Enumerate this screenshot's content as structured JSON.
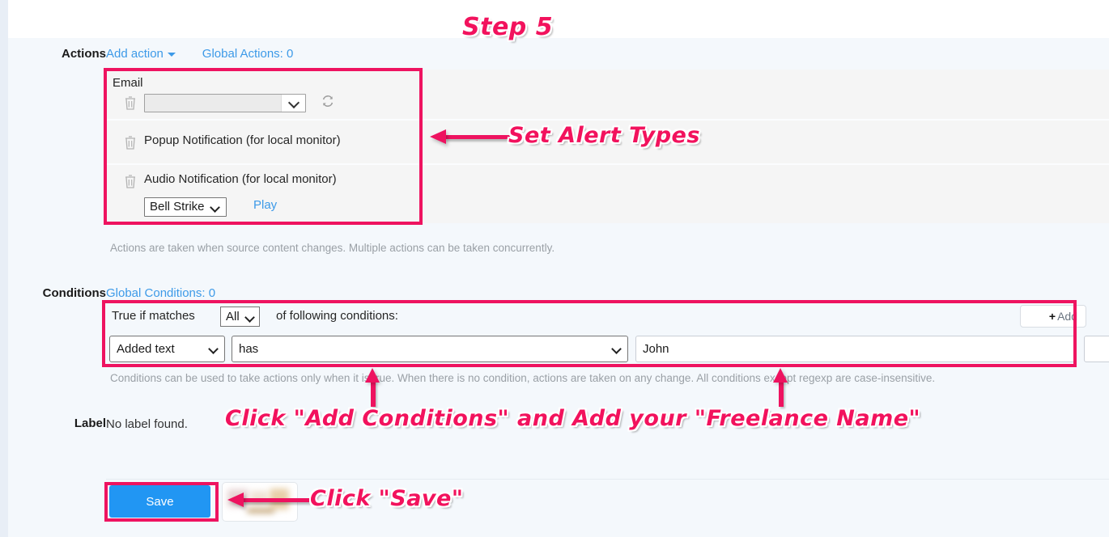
{
  "theme": {
    "accent_pink": "#ee1360",
    "link_blue": "#3d9ae8",
    "save_blue": "#2196f3",
    "page_bg": "#f4f8fc",
    "row_bg": "#f5f5f5",
    "help_text_color": "#9aa0a6"
  },
  "actions": {
    "row_label": "Actions",
    "add_action_link": "Add action",
    "global_actions_link": "Global Actions: 0",
    "items": [
      {
        "title": "Email",
        "select_value": "",
        "trash_icon": "trash-icon",
        "refresh_icon": "refresh-icon"
      },
      {
        "label": "Popup Notification (for local monitor)",
        "trash_icon": "trash-icon"
      },
      {
        "label": "Audio Notification (for local monitor)",
        "trash_icon": "trash-icon",
        "sound_value": "Bell Strike",
        "play_link": "Play"
      }
    ],
    "help_text": "Actions are taken when source content changes. Multiple actions can be taken concurrently."
  },
  "conditions": {
    "row_label": "Conditions",
    "global_conditions_link": "Global Conditions: 0",
    "true_if_matches_prefix": "True if matches",
    "match_value": "All",
    "true_if_matches_suffix": "of following conditions:",
    "add_button_label": "Add",
    "add_button_plus": "+",
    "rule": {
      "field_value": "Added text",
      "operator_value": "has",
      "text_value": "John"
    },
    "help_text": "Conditions can be used to take actions only when it is true. When there is no condition, actions are taken on any change. All conditions except regexp are case-insensitive."
  },
  "label_section": {
    "row_label": "Label",
    "value": "No label found."
  },
  "footer": {
    "save_label": "Save",
    "secondary_button_label": ""
  },
  "annotations": {
    "step_title": "Step 5",
    "set_alert_types": "Set Alert Types",
    "add_conditions": "Click \"Add Conditions\" and Add your \"Freelance Name\"",
    "click_save": "Click \"Save\""
  }
}
